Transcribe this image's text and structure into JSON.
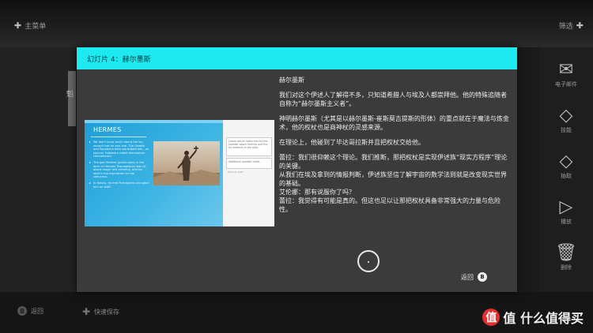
{
  "background": {
    "top_left_label": "主菜单",
    "top_right_label": "筛选",
    "left_thumb_label": "魁",
    "side_menu": [
      {
        "icon": "email-icon",
        "label": "电子邮件"
      },
      {
        "icon": "diamond-icon",
        "label": "技能"
      },
      {
        "icon": "diamond-icon",
        "label": "抽取"
      },
      {
        "icon": "play-icon",
        "label": "播放"
      },
      {
        "icon": "trash-icon",
        "label": "删除"
      }
    ],
    "bottom_back_label": "返回",
    "bottom_back_key": "B",
    "bottom_save_label": "快速保存",
    "watermark_text": "值 什么值得买",
    "watermark_logo": "值"
  },
  "dialog": {
    "title": "幻灯片 4：赫尔墨斯",
    "accent_color": "#1ee9f0",
    "slide": {
      "title": "HERMES",
      "bullets": [
        "We don't know much about the Isu, except that he was one. The Greeks and Egyptians both worshiped him - as special. Followers called themselves Hermeticists.",
        "The god Hermes (particularly in the form of Hermes Trismegistus) was all about magic and alchemy, and his staff is the inspiration for the caduceus.",
        "In theory, he met Pythagoras and gave him an staff."
      ],
      "notes": "Lorem ipsum notes text for the speaker about Hermes and the Isu artifacts in the slide.",
      "notes2": "Additional speaker notes.",
      "notes3": "- Hermes staff"
    },
    "text": {
      "heading": "赫尔墨斯",
      "p1": "我们对这个伊述人了解得不多，只知道希腊人与埃及人都崇拜他。他的特殊追随者自称为“赫尔墨斯主义者”。",
      "p2": "神明赫尔墨斯（尤其是以赫尔墨斯-崔斯莫吉提斯的形体）的重点就在于魔法与炼金术，他的权杖也是商神杖的灵感来源。",
      "p3": "在理论上，他碰到了毕达哥拉斯并且把权杖交给他。",
      "d1": "蕾拉：我们很仰赖这个理论。我们推断，那把权杖是实现伊述族“现实方程序”理论的关键。",
      "d2": "从我们在埃及拿到的情报判断，伊述族坚信了解宇宙的数学法则就是改变现实世界的基础。",
      "d3": "艾伦娜：那有说服你了吗？",
      "d4": "蕾拉：我觉得有可能是真的。但这也足以让那把权杖具备非常强大的力量与危险性。"
    },
    "back_label": "返回",
    "back_key": "B"
  }
}
